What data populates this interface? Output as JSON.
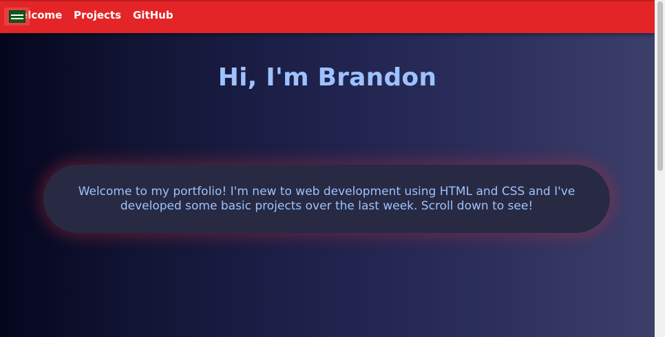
{
  "nav": {
    "items": [
      {
        "label": "Welcome"
      },
      {
        "label": "Projects"
      },
      {
        "label": "GitHub"
      }
    ]
  },
  "hero": {
    "title": "Hi, I'm Brandon"
  },
  "intro": {
    "text": "Welcome to my portfolio! I'm new to web development using HTML and CSS and I've developed some basic projects over the last week. Scroll down to see!"
  },
  "colors": {
    "navbar": "#e42528",
    "accent_text": "#9ec1ff",
    "card": "#272a42"
  },
  "icons": {
    "overlay": "flag-icon"
  }
}
